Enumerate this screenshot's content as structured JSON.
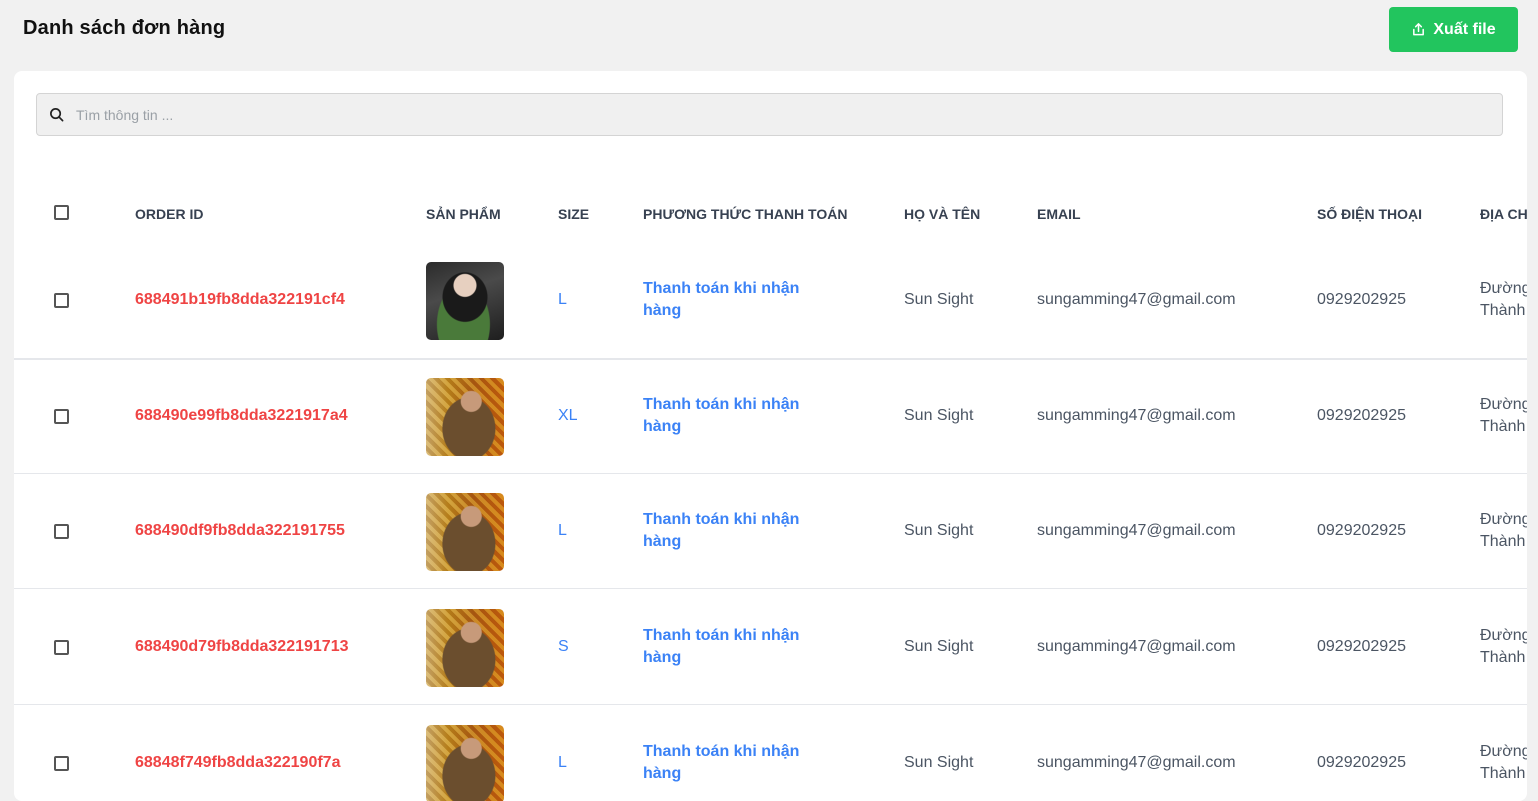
{
  "header": {
    "title": "Danh sách đơn hàng",
    "export_label": "Xuất file",
    "export_icon": "upload-icon"
  },
  "search": {
    "placeholder": "Tìm thông tin ...",
    "value": ""
  },
  "table": {
    "columns": [
      "ORDER ID",
      "SẢN PHẨM",
      "SIZE",
      "PHƯƠNG THỨC THANH TOÁN",
      "HỌ VÀ TÊN",
      "EMAIL",
      "SỐ ĐIỆN THOẠI",
      "ĐỊA CH"
    ],
    "rows": [
      {
        "order_id": "688491b19fb8dda322191cf4",
        "size": "L",
        "payment": "Thanh toán khi nhận hàng",
        "name": "Sun Sight",
        "email": "sungamming47@gmail.com",
        "phone": "0929202925",
        "address": "Đường Thành"
      },
      {
        "order_id": "688490e99fb8dda3221917a4",
        "size": "XL",
        "payment": "Thanh toán khi nhận hàng",
        "name": "Sun Sight",
        "email": "sungamming47@gmail.com",
        "phone": "0929202925",
        "address": "Đường Thành"
      },
      {
        "order_id": "688490df9fb8dda322191755",
        "size": "L",
        "payment": "Thanh toán khi nhận hàng",
        "name": "Sun Sight",
        "email": "sungamming47@gmail.com",
        "phone": "0929202925",
        "address": "Đường Thành"
      },
      {
        "order_id": "688490d79fb8dda322191713",
        "size": "S",
        "payment": "Thanh toán khi nhận hàng",
        "name": "Sun Sight",
        "email": "sungamming47@gmail.com",
        "phone": "0929202925",
        "address": "Đường Thành"
      },
      {
        "order_id": "68848f749fb8dda322190f7a",
        "size": "L",
        "payment": "Thanh toán khi nhận hàng",
        "name": "Sun Sight",
        "email": "sungamming47@gmail.com",
        "phone": "0929202925",
        "address": "Đường Thành"
      }
    ]
  }
}
